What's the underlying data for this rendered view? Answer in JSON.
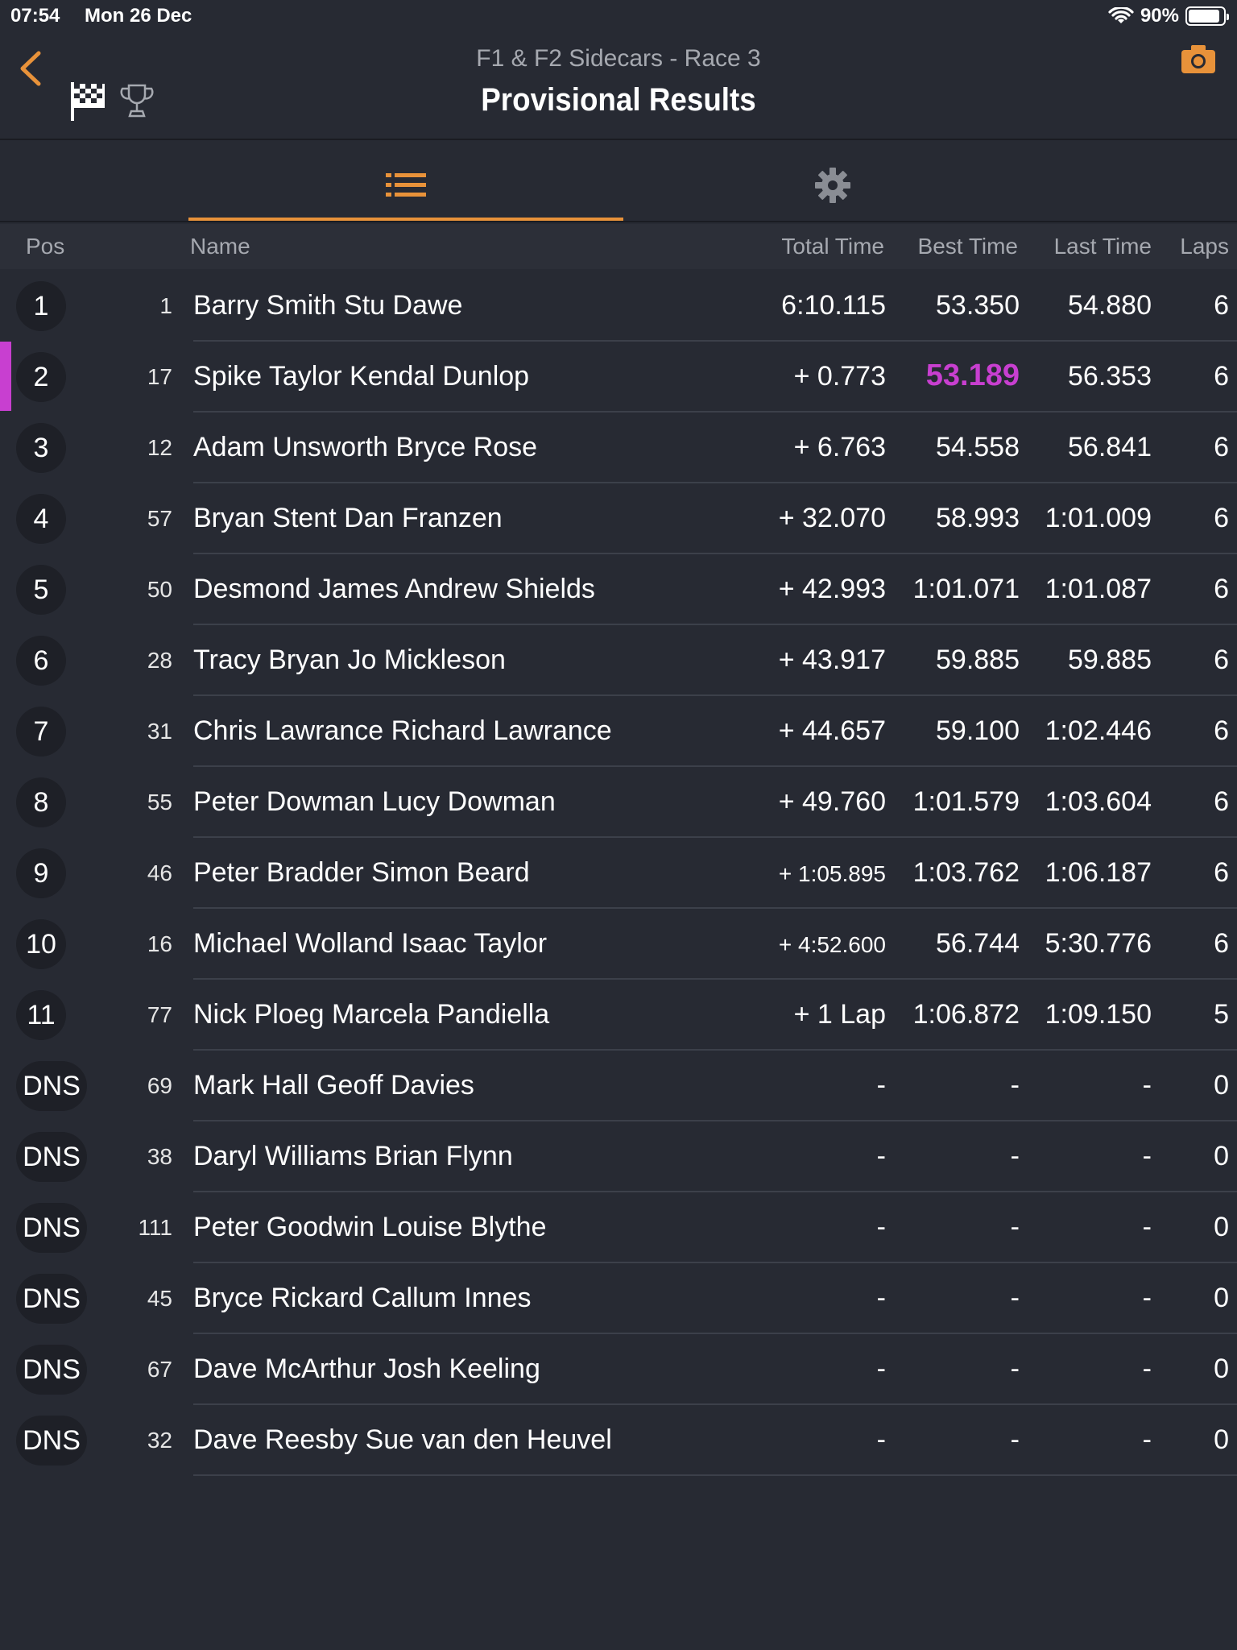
{
  "status": {
    "time": "07:54",
    "date": "Mon 26 Dec",
    "battery": "90%",
    "battery_level": 0.9
  },
  "nav": {
    "subtitle": "F1 & F2 Sidecars - Race 3",
    "title": "Provisional Results"
  },
  "icons": {
    "back": "chevron-left-icon",
    "flag": "checkered-flag-icon",
    "trophy": "trophy-icon",
    "camera": "camera-icon",
    "list": "list-icon",
    "settings": "gear-icon"
  },
  "colors": {
    "accent": "#e8923a",
    "fastest": "#c83fd0",
    "background": "#272a33"
  },
  "columns": {
    "pos": "Pos",
    "name": "Name",
    "total": "Total Time",
    "best": "Best Time",
    "last": "Last Time",
    "laps": "Laps"
  },
  "rows": [
    {
      "pos": "1",
      "num": "1",
      "name": "Barry Smith Stu Dawe",
      "total": "6:10.115",
      "best": "53.350",
      "last": "54.880",
      "laps": "6"
    },
    {
      "pos": "2",
      "num": "17",
      "name": "Spike Taylor Kendal Dunlop",
      "total": "+ 0.773",
      "best": "53.189",
      "last": "56.353",
      "laps": "6",
      "fastest": true
    },
    {
      "pos": "3",
      "num": "12",
      "name": "Adam Unsworth Bryce Rose",
      "total": "+ 6.763",
      "best": "54.558",
      "last": "56.841",
      "laps": "6"
    },
    {
      "pos": "4",
      "num": "57",
      "name": "Bryan Stent Dan Franzen",
      "total": "+ 32.070",
      "best": "58.993",
      "last": "1:01.009",
      "laps": "6"
    },
    {
      "pos": "5",
      "num": "50",
      "name": "Desmond James Andrew Shields",
      "total": "+ 42.993",
      "best": "1:01.071",
      "last": "1:01.087",
      "laps": "6"
    },
    {
      "pos": "6",
      "num": "28",
      "name": "Tracy Bryan Jo Mickleson",
      "total": "+ 43.917",
      "best": "59.885",
      "last": "59.885",
      "laps": "6"
    },
    {
      "pos": "7",
      "num": "31",
      "name": "Chris Lawrance Richard Lawrance",
      "total": "+ 44.657",
      "best": "59.100",
      "last": "1:02.446",
      "laps": "6"
    },
    {
      "pos": "8",
      "num": "55",
      "name": "Peter Dowman Lucy Dowman",
      "total": "+ 49.760",
      "best": "1:01.579",
      "last": "1:03.604",
      "laps": "6"
    },
    {
      "pos": "9",
      "num": "46",
      "name": "Peter Bradder Simon Beard",
      "total": "+ 1:05.895",
      "best": "1:03.762",
      "last": "1:06.187",
      "laps": "6",
      "small": true
    },
    {
      "pos": "10",
      "num": "16",
      "name": "Michael Wolland Isaac Taylor",
      "total": "+ 4:52.600",
      "best": "56.744",
      "last": "5:30.776",
      "laps": "6",
      "small": true
    },
    {
      "pos": "11",
      "num": "77",
      "name": "Nick Ploeg Marcela Pandiella",
      "total": "+ 1 Lap",
      "best": "1:06.872",
      "last": "1:09.150",
      "laps": "5"
    },
    {
      "pos": "DNS",
      "num": "69",
      "name": "Mark Hall Geoff Davies",
      "total": "-",
      "best": "-",
      "last": "-",
      "laps": "0"
    },
    {
      "pos": "DNS",
      "num": "38",
      "name": "Daryl Williams Brian Flynn",
      "total": "-",
      "best": "-",
      "last": "-",
      "laps": "0"
    },
    {
      "pos": "DNS",
      "num": "111",
      "name": "Peter Goodwin Louise Blythe",
      "total": "-",
      "best": "-",
      "last": "-",
      "laps": "0"
    },
    {
      "pos": "DNS",
      "num": "45",
      "name": "Bryce Rickard Callum Innes",
      "total": "-",
      "best": "-",
      "last": "-",
      "laps": "0"
    },
    {
      "pos": "DNS",
      "num": "67",
      "name": "Dave McArthur Josh Keeling",
      "total": "-",
      "best": "-",
      "last": "-",
      "laps": "0"
    },
    {
      "pos": "DNS",
      "num": "32",
      "name": "Dave Reesby Sue van den Heuvel",
      "total": "-",
      "best": "-",
      "last": "-",
      "laps": "0"
    }
  ]
}
